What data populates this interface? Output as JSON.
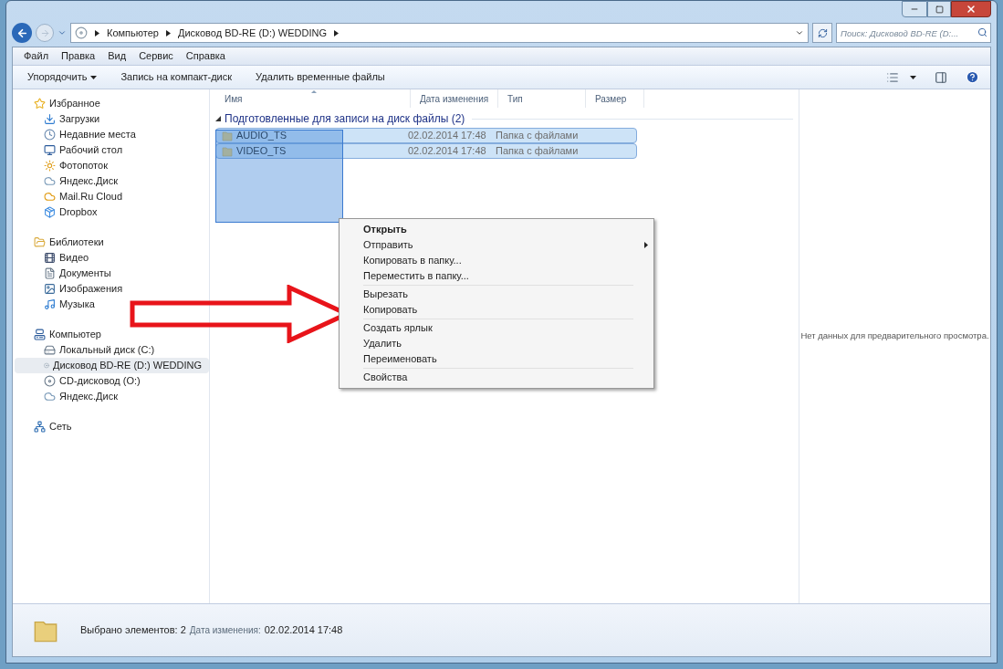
{
  "address": {
    "breadcrumbs": [
      "Компьютер",
      "Дисковод BD-RE (D:) WEDDING"
    ]
  },
  "search": {
    "placeholder": "Поиск: Дисковод BD-RE (D:..."
  },
  "menu_bar": [
    "Файл",
    "Правка",
    "Вид",
    "Сервис",
    "Справка"
  ],
  "toolbar": [
    {
      "label": "Упорядочить",
      "dropdown": true
    },
    {
      "label": "Запись на компакт-диск",
      "dropdown": false
    },
    {
      "label": "Удалить временные файлы",
      "dropdown": false
    }
  ],
  "sidebar": {
    "groups": [
      {
        "label": "Избранное",
        "children": [
          {
            "label": "Загрузки",
            "selected": false
          },
          {
            "label": "Недавние места",
            "selected": false
          },
          {
            "label": "Рабочий стол",
            "selected": false
          },
          {
            "label": "Фотопоток",
            "selected": false
          },
          {
            "label": "Яндекс.Диск",
            "selected": false
          },
          {
            "label": "Mail.Ru Cloud",
            "selected": false
          },
          {
            "label": "Dropbox",
            "selected": false
          }
        ]
      },
      {
        "label": "Библиотеки",
        "children": [
          {
            "label": "Видео",
            "selected": false
          },
          {
            "label": "Документы",
            "selected": false
          },
          {
            "label": "Изображения",
            "selected": false
          },
          {
            "label": "Музыка",
            "selected": false
          }
        ]
      },
      {
        "label": "Компьютер",
        "children": [
          {
            "label": "Локальный диск (C:)",
            "selected": false
          },
          {
            "label": "Дисковод BD-RE (D:) WEDDING",
            "selected": true
          },
          {
            "label": "CD-дисковод (O:)",
            "selected": false
          },
          {
            "label": "Яндекс.Диск",
            "selected": false
          }
        ]
      },
      {
        "label": "Сеть"
      }
    ]
  },
  "table": {
    "columns": [
      "Имя",
      "Дата изменения",
      "Тип",
      "Размер"
    ],
    "group": {
      "label": "Подготовленные для записи на диск файлы (2)",
      "expanded": true
    },
    "rows": [
      {
        "name": "AUDIO_TS",
        "date": "02.02.2014 17:48",
        "type": "Папка с файлами",
        "selected": true
      },
      {
        "name": "VIDEO_TS",
        "date": "02.02.2014 17:48",
        "type": "Папка с файлами",
        "selected": true
      }
    ]
  },
  "context_menu": {
    "sections": [
      [
        {
          "label": "Открыть",
          "default": true,
          "submenu": false
        },
        {
          "label": "Отправить",
          "default": false,
          "submenu": true
        },
        {
          "label": "Копировать в папку...",
          "default": false,
          "submenu": false
        },
        {
          "label": "Переместить в папку...",
          "default": false,
          "submenu": false
        }
      ],
      [
        {
          "label": "Вырезать",
          "default": false,
          "submenu": false
        },
        {
          "label": "Копировать",
          "default": false,
          "submenu": false
        }
      ],
      [
        {
          "label": "Создать ярлык",
          "default": false,
          "submenu": false
        },
        {
          "label": "Удалить",
          "default": false,
          "submenu": false
        },
        {
          "label": "Переименовать",
          "default": false,
          "submenu": false
        }
      ],
      [
        {
          "label": "Свойства",
          "default": false,
          "submenu": false
        }
      ]
    ]
  },
  "preview": {
    "text": "Нет данных для предварительного просмотра."
  },
  "status_bar": {
    "count": "Выбрано элементов: 2",
    "date_label": "Дата изменения:",
    "date": "02.02.2014 17:48"
  }
}
